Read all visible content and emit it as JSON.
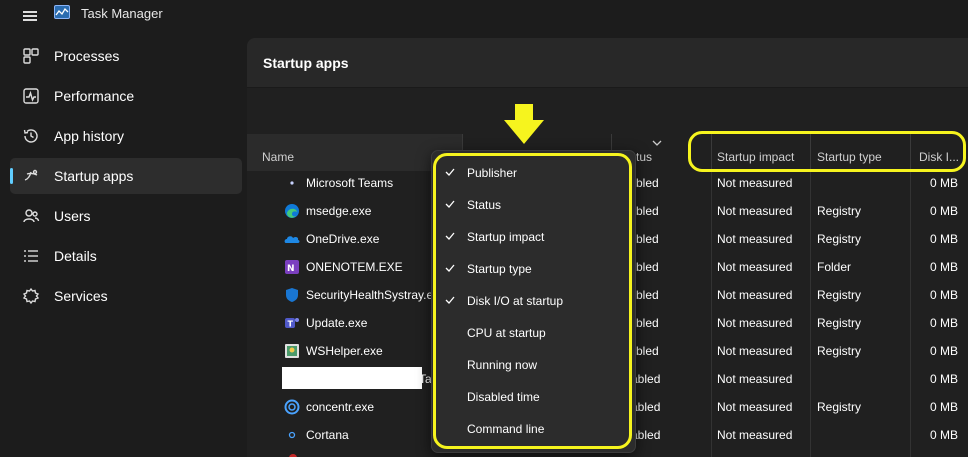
{
  "window": {
    "title": "Task Manager"
  },
  "sidebar": {
    "items": [
      {
        "label": "Processes",
        "icon": "processes-icon"
      },
      {
        "label": "Performance",
        "icon": "performance-icon"
      },
      {
        "label": "App history",
        "icon": "history-icon"
      },
      {
        "label": "Startup apps",
        "icon": "startup-icon",
        "active": true
      },
      {
        "label": "Users",
        "icon": "users-icon"
      },
      {
        "label": "Details",
        "icon": "details-icon"
      },
      {
        "label": "Services",
        "icon": "services-icon"
      }
    ]
  },
  "main": {
    "title": "Startup apps",
    "columns": {
      "name": "Name",
      "status": "tus",
      "impact": "Startup impact",
      "type": "Startup type",
      "disk": "Disk I..."
    },
    "rows": [
      {
        "name": "Microsoft Teams",
        "status": "bled",
        "impact": "Not measured",
        "type": "",
        "disk": "0 MB",
        "icon": "teams-small-icon"
      },
      {
        "name": "msedge.exe",
        "status": "bled",
        "impact": "Not measured",
        "type": "Registry",
        "disk": "0 MB",
        "icon": "edge-icon"
      },
      {
        "name": "OneDrive.exe",
        "status": "bled",
        "impact": "Not measured",
        "type": "Registry",
        "disk": "0 MB",
        "icon": "onedrive-icon"
      },
      {
        "name": "ONENOTEM.EXE",
        "status": "bled",
        "impact": "Not measured",
        "type": "Folder",
        "disk": "0 MB",
        "icon": "onenote-icon"
      },
      {
        "name": "SecurityHealthSystray.ex",
        "status": "bled",
        "impact": "Not measured",
        "type": "Registry",
        "disk": "0 MB",
        "icon": "security-shield-icon"
      },
      {
        "name": "Update.exe",
        "status": "bled",
        "impact": "Not measured",
        "type": "Registry",
        "disk": "0 MB",
        "icon": "teams-icon"
      },
      {
        "name": "WSHelper.exe",
        "status": "bled",
        "impact": "Not measured",
        "type": "Registry",
        "disk": "0 MB",
        "icon": "wshelper-icon"
      },
      {
        "name": "Ta",
        "status": "abled",
        "impact": "Not measured",
        "type": "",
        "disk": "0 MB",
        "icon": ""
      },
      {
        "name": "concentr.exe",
        "status": "abled",
        "impact": "Not measured",
        "type": "Registry",
        "disk": "0 MB",
        "icon": "citrix-icon"
      },
      {
        "name": "Cortana",
        "status": "abled",
        "impact": "Not measured",
        "type": "",
        "disk": "0 MB",
        "icon": "cortana-icon"
      }
    ]
  },
  "context_menu": {
    "items": [
      {
        "label": "Publisher",
        "checked": true
      },
      {
        "label": "Status",
        "checked": true
      },
      {
        "label": "Startup impact",
        "checked": true
      },
      {
        "label": "Startup type",
        "checked": true
      },
      {
        "label": "Disk I/O at startup",
        "checked": true
      },
      {
        "label": "CPU at startup",
        "checked": false
      },
      {
        "label": "Running now",
        "checked": false
      },
      {
        "label": "Disabled time",
        "checked": false
      },
      {
        "label": "Command line",
        "checked": false
      }
    ]
  },
  "annotations": {
    "highlight_color": "#f6f41e",
    "accent": "#60cdff"
  }
}
